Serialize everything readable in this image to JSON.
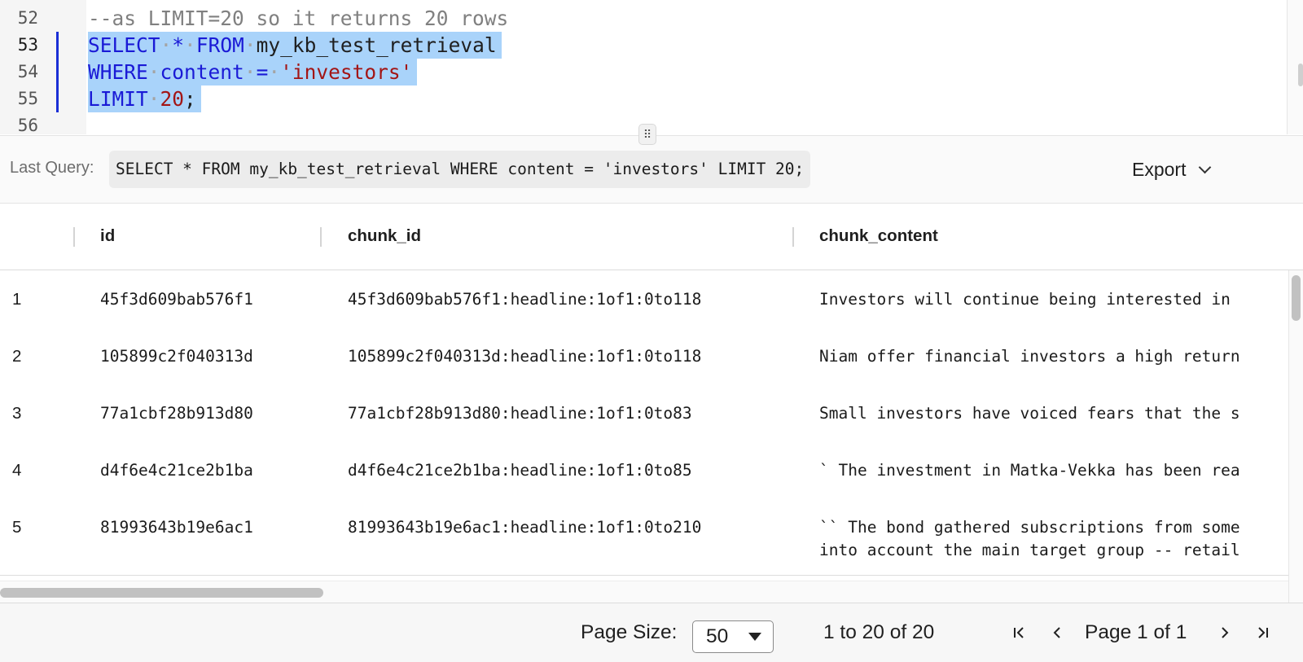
{
  "editor": {
    "lines": [
      {
        "number": "52",
        "text": "--as LIMIT=20 so it returns 20 rows"
      },
      {
        "number": "53",
        "text": "SELECT * FROM my_kb_test_retrieval"
      },
      {
        "number": "54",
        "text": "WHERE content = 'investors'"
      },
      {
        "number": "55",
        "text": "LIMIT 20;"
      },
      {
        "number": "56",
        "text": ""
      }
    ],
    "tokens": {
      "select": "SELECT",
      "star": "*",
      "from": "FROM",
      "table": "my_kb_test_retrieval",
      "where": "WHERE",
      "column": "content",
      "eq": "=",
      "value": "'investors'",
      "limit": "LIMIT",
      "limit_num": "20",
      "semicolon": ";"
    },
    "resize_handle_glyph": "⠿"
  },
  "last_query": {
    "label": "Last Query:",
    "value": "SELECT * FROM my_kb_test_retrieval WHERE content = 'investors' LIMIT 20;"
  },
  "export": {
    "label": "Export"
  },
  "grid": {
    "columns": [
      "id",
      "chunk_id",
      "chunk_content"
    ],
    "rows": [
      {
        "n": "1",
        "id": "45f3d609bab576f1",
        "chunk_id": "45f3d609bab576f1:headline:1of1:0to118",
        "content": "Investors will continue being interested in"
      },
      {
        "n": "2",
        "id": "105899c2f040313d",
        "chunk_id": "105899c2f040313d:headline:1of1:0to118",
        "content": "Niam offer financial investors a high return"
      },
      {
        "n": "3",
        "id": "77a1cbf28b913d80",
        "chunk_id": "77a1cbf28b913d80:headline:1of1:0to83",
        "content": "Small investors have voiced fears that the s"
      },
      {
        "n": "4",
        "id": "d4f6e4c21ce2b1ba",
        "chunk_id": "d4f6e4c21ce2b1ba:headline:1of1:0to85",
        "content": "` The investment in Matka-Vekka has been rea"
      },
      {
        "n": "5",
        "id": "81993643b19e6ac1",
        "chunk_id": "81993643b19e6ac1:headline:1of1:0to210",
        "content": "`` The bond gathered subscriptions from some\ninto account the main target group -- retail"
      }
    ]
  },
  "footer": {
    "page_size_label": "Page Size:",
    "page_size_value": "50",
    "range_text": "1 to 20 of 20",
    "page_text": "Page 1 of 1"
  },
  "icons": {
    "first_page": "first-page-icon",
    "prev_page": "prev-page-icon",
    "next_page": "next-page-icon",
    "last_page": "last-page-icon",
    "export_chevron": "chevron-down-icon"
  },
  "colors": {
    "keyword": "#1a1ad6",
    "string": "#a31515",
    "number": "#098658",
    "comment": "#808080",
    "selection": "#a9d3fa",
    "change_bar": "#1a2fd6"
  }
}
